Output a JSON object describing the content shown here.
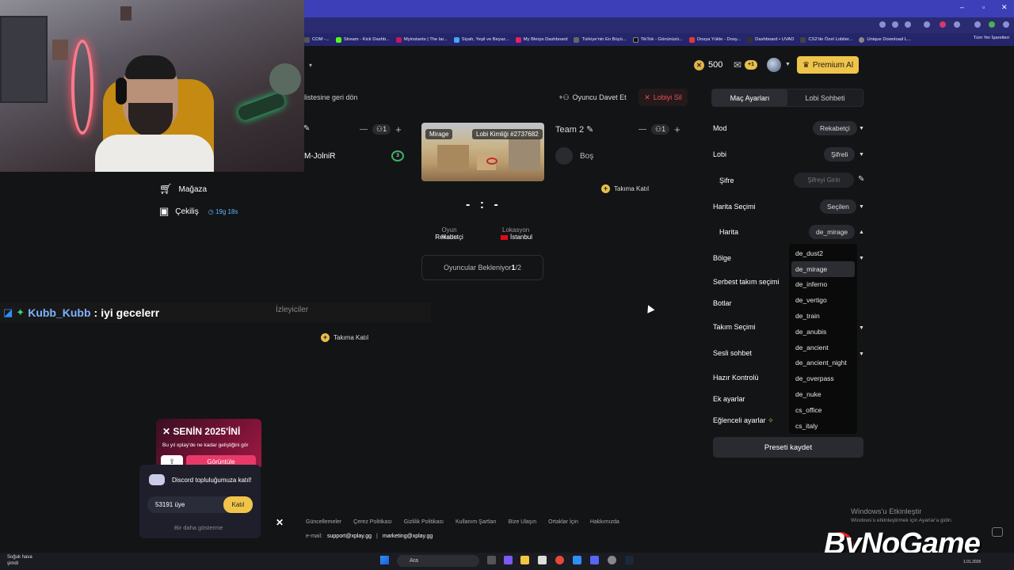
{
  "bookmarks": [
    "COM -...",
    "Stream - Kick Dashb...",
    "Myinstants | The lar...",
    "Siyah, Yeşil ve Beyaz...",
    "My Blerps Dashboard",
    "Türkiye'nin En Büyü...",
    "TikTok - Gönünüzü...",
    "Dosya Yükle - Dosy...",
    "Dashboard • UVAD",
    "CS2'de Özel Lobiler...",
    "Unique Download L..."
  ],
  "bookmarks_right": "Tüm Yer İşaretleri",
  "topbar": {
    "coins": "500",
    "mail_badge": "+1",
    "premium_label": "Premium Al"
  },
  "sidebar": {
    "back_label": "listesine geri dön",
    "shop_label": "Mağaza",
    "giveaway_label": "Çekiliş",
    "giveaway_timer": "19g 18s"
  },
  "lobby": {
    "invite_label": "Oyuncu Davet Et",
    "delete_label": "Lobiyi Sil",
    "team1_count": "1",
    "team2_name": "Team 2",
    "team2_count": "1",
    "player1_name": "M-JolniR",
    "player1_badge": "3",
    "empty_slot": "Boş",
    "join_team_label": "Takıma Katıl",
    "map_name": "Mirage",
    "lobby_id": "Lobi Kimliği #2737682",
    "score": "- : -",
    "mode_label": "Oyun Modu",
    "mode_value": "Rekabetçi",
    "location_label": "Lokasyon",
    "location_value": "İstanbul",
    "waiting_prefix": "Oyuncular Bekleniyor ",
    "waiting_count": "1",
    "waiting_total": "/2",
    "spectators_label": "İzleyiciler"
  },
  "chat": {
    "user": "Kubb_Kubb",
    "separator": " : ",
    "message": "iyi gecelerr"
  },
  "settings": {
    "tab_match": "Maç Ayarları",
    "tab_chat": "Lobi Sohbeti",
    "mode_label": "Mod",
    "mode_value": "Rekabetçi",
    "lobby_label": "Lobi",
    "lobby_value": "Şifreli",
    "password_label": "Şifre",
    "password_placeholder": "Şifreyi Girin",
    "map_select_label": "Harita Seçimi",
    "map_select_value": "Seçilen",
    "map_label": "Harita",
    "map_value": "de_mirage",
    "region_label": "Bölge",
    "free_team_label": "Serbest takım seçimi",
    "bots_label": "Botlar",
    "team_select_label": "Takım Seçimi",
    "voice_label": "Sesli sohbet",
    "ready_label": "Hazır Kontrolü",
    "extra_label": "Ek ayarlar",
    "fun_label": "Eğlenceli ayarlar",
    "preset_label": "Preseti kaydet",
    "map_options": [
      "de_dust2",
      "de_mirage",
      "de_inferno",
      "de_vertigo",
      "de_train",
      "de_anubis",
      "de_ancient",
      "de_ancient_night",
      "de_overpass",
      "de_nuke",
      "cs_office",
      "cs_italy"
    ],
    "selected_index": 1
  },
  "promo": {
    "title": "SENİN 2025'İNİ",
    "subtitle": "Bu yıl xplay'de ne kadar geliştiğini gör",
    "view_label": "Görüntüle"
  },
  "discord": {
    "text": "Discord topluluğumuza katıl!",
    "members": "53191 üye",
    "join_label": "Katıl",
    "dismiss_label": "Bir daha gösterme"
  },
  "footer": {
    "links": [
      "Güncellemeler",
      "Çerez Politikası",
      "Gizlilik Politikası",
      "Kullanım Şartları",
      "Bize Ulaşın",
      "Ortaklar İçin",
      "Hakkımızda"
    ],
    "email_label": "e-mail:",
    "email_support": "support@xplay.gg",
    "email_marketing": "marketing@xplay.gg"
  },
  "windows": {
    "activate_title": "Windows'u Etkinleştir",
    "activate_sub": "Windows'u etkinleştirmek için Ayarlar'a gidin.",
    "weather_line1": "Soğuk hava",
    "weather_line2": "şimdi",
    "search_label": "Ara",
    "date": "1.01.2026"
  },
  "watermark": "ByNoGame"
}
